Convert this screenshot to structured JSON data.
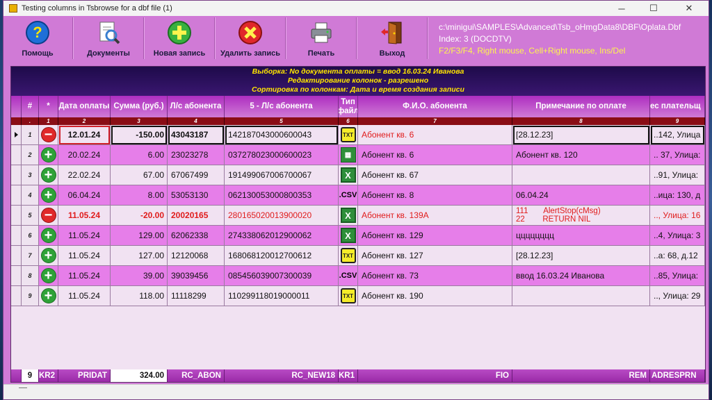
{
  "window": {
    "title": "Testing columns in Tsbrowse for a dbf file (1)",
    "controls": [
      "─",
      "☐",
      "✕"
    ]
  },
  "toolbar": {
    "buttons": [
      {
        "label": "Помощь",
        "icon": "help-icon"
      },
      {
        "label": "Документы",
        "icon": "documents-icon"
      },
      {
        "label": "Новая запись",
        "icon": "add-icon"
      },
      {
        "label": "Удалить запись",
        "icon": "delete-icon"
      },
      {
        "label": "Печать",
        "icon": "printer-icon"
      },
      {
        "label": "Выход",
        "icon": "exit-door-icon"
      }
    ],
    "info": {
      "path": "c:\\minigui\\SAMPLES\\Advanced\\Tsb_oHmgData8\\DBF\\Oplata.Dbf",
      "index": "Index: 3 (DOCDTV)",
      "keys": "F2/F3/F4, Right mouse,  Cell+Right mouse, Ins/Del"
    }
  },
  "banner": {
    "line1": "Выборка: No документа оплаты = ввод 16.03.24 Иванова",
    "line2": "Редактирование колонок - разрешено",
    "line3": "Сортировка по колонкам: Дата и время создания записи"
  },
  "columns": {
    "headers": [
      "#",
      "*",
      "Дата оплаты",
      "Сумма (руб.)",
      "Л/с абонента",
      "5 - Л/с абонента",
      "Тип файл",
      "Ф.И.О. абонента",
      "Примечание по оплате",
      "ес плательщ"
    ],
    "numbers": [
      ".",
      "1",
      "2",
      "3",
      "4",
      "5",
      "6",
      "7",
      "8",
      "9"
    ]
  },
  "rows": [
    {
      "n": "1",
      "status": "minus",
      "date": "12.01.24",
      "sum": "-150.00",
      "ls": "43043187",
      "ls5": "142187043000600043",
      "ftype": "txt",
      "fio": "Абонент кв. 6",
      "note": "[28.12.23]",
      "addr": "..142, Улица"
    },
    {
      "n": "2",
      "status": "plus",
      "date": "20.02.24",
      "sum": "6.00",
      "ls": "23023278",
      "ls5": "037278023000600023",
      "ftype": "xlsx",
      "fio": "Абонент кв. 6",
      "note": " Абонент кв. 120",
      "addr": ".. 37, Улица:"
    },
    {
      "n": "3",
      "status": "plus",
      "date": "22.02.24",
      "sum": "67.00",
      "ls": "67067499",
      "ls5": "191499067006700067",
      "ftype": "xl",
      "fio": "Абонент кв. 67",
      "note": "",
      "addr": "..91, Улица:"
    },
    {
      "n": "4",
      "status": "plus",
      "date": "06.04.24",
      "sum": "8.00",
      "ls": "53053130",
      "ls5": "062130053000800353",
      "ftype": "csv",
      "fio": "Абонент кв. 8",
      "note": "06.04.24",
      "addr": "..ица: 130, д"
    },
    {
      "n": "5",
      "status": "minus",
      "date": "11.05.24",
      "sum": "-20.00",
      "ls": "20020165",
      "ls5": "280165020013900020",
      "ftype": "xl",
      "fio": "Абонент кв. 139А",
      "note": "111       AlertStop(cMsg)\n22        RETURN NIL",
      "addr": ".., Улица: 16"
    },
    {
      "n": "6",
      "status": "plus",
      "date": "11.05.24",
      "sum": "129.00",
      "ls": "62062338",
      "ls5": "274338062012900062",
      "ftype": "xl",
      "fio": "Абонент кв. 129",
      "note": "цццццццц",
      "addr": "..4, Улица: 3"
    },
    {
      "n": "7",
      "status": "plus",
      "date": "11.05.24",
      "sum": "127.00",
      "ls": "12120068",
      "ls5": "168068120012700612",
      "ftype": "txt",
      "fio": "Абонент кв. 127",
      "note": "[28.12.23]",
      "addr": "..а: 68, д.12"
    },
    {
      "n": "8",
      "status": "plus",
      "date": "11.05.24",
      "sum": "39.00",
      "ls": "39039456",
      "ls5": "085456039007300039",
      "ftype": "csv",
      "fio": "Абонент кв. 73",
      "note": "ввод 16.03.24 Иванова",
      "addr": "..85, Улица:"
    },
    {
      "n": "9",
      "status": "plus",
      "date": "11.05.24",
      "sum": "118.00",
      "ls": "11118299",
      "ls5": "110299118019000011",
      "ftype": "txt",
      "fio": "Абонент кв. 190",
      "note": "",
      "addr": ".., Улица: 29"
    }
  ],
  "footer": {
    "count": "9",
    "c2": "KR2",
    "c3": "PRIDAT",
    "c4": "324.00",
    "c5": "RC_ABON",
    "c6": "RC_NEW18",
    "c7": "KR1",
    "c8": "FIO",
    "c9": "REM",
    "c10": "ADRESPRN"
  },
  "colors": {
    "window_bg": "#d07ad6",
    "row_odd": "#f1e2f2",
    "row_even": "#e67ee9",
    "banner_text": "#ffe500",
    "header_number_bg": "#8a0d16",
    "negative_text": "#e01b1b"
  }
}
